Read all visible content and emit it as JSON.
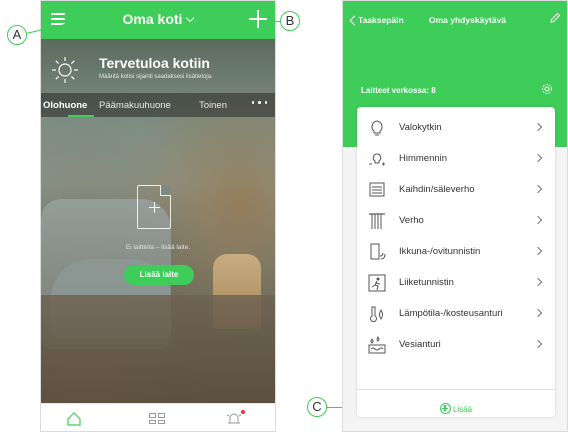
{
  "left_screen": {
    "header": {
      "title": "Oma koti"
    },
    "welcome": {
      "title": "Tervetuloa kotiin",
      "subtitle": "Määritä kotisi sijainti saadaksesi lisätietoja."
    },
    "tabs": [
      {
        "label": "Olohuone",
        "active": true
      },
      {
        "label": "Päämakuuhuone",
        "active": false
      },
      {
        "label": "Toinen",
        "active": false
      }
    ],
    "empty_state": {
      "message": "Ei laitteita – lisää laite.",
      "button_label": "Lisää laite"
    },
    "bottom_nav": [
      "home-icon",
      "grid-icon",
      "alarm-icon"
    ]
  },
  "right_screen": {
    "header": {
      "back_label": "Taaksepäin",
      "title": "Oma yhdyskäytävä"
    },
    "devices_label": "Laitteet verkossa: 8",
    "devices": [
      {
        "label": "Valokytkin",
        "icon": "lightbulb-icon"
      },
      {
        "label": "Himmennin",
        "icon": "dimmer-icon"
      },
      {
        "label": "Kaihdin/säleverho",
        "icon": "blind-icon"
      },
      {
        "label": "Verho",
        "icon": "curtain-icon"
      },
      {
        "label": "Ikkuna-/ovitunnistin",
        "icon": "door-sensor-icon"
      },
      {
        "label": "Liiketunnistin",
        "icon": "motion-sensor-icon"
      },
      {
        "label": "Lämpötila-/kosteusanturi",
        "icon": "temp-humidity-icon"
      },
      {
        "label": "Vesianturi",
        "icon": "water-sensor-icon"
      }
    ],
    "add_label": "Lisää"
  },
  "callouts": {
    "a": "A",
    "b": "B",
    "c": "C"
  },
  "colors": {
    "accent": "#3dcd58",
    "notification": "#e53935"
  }
}
